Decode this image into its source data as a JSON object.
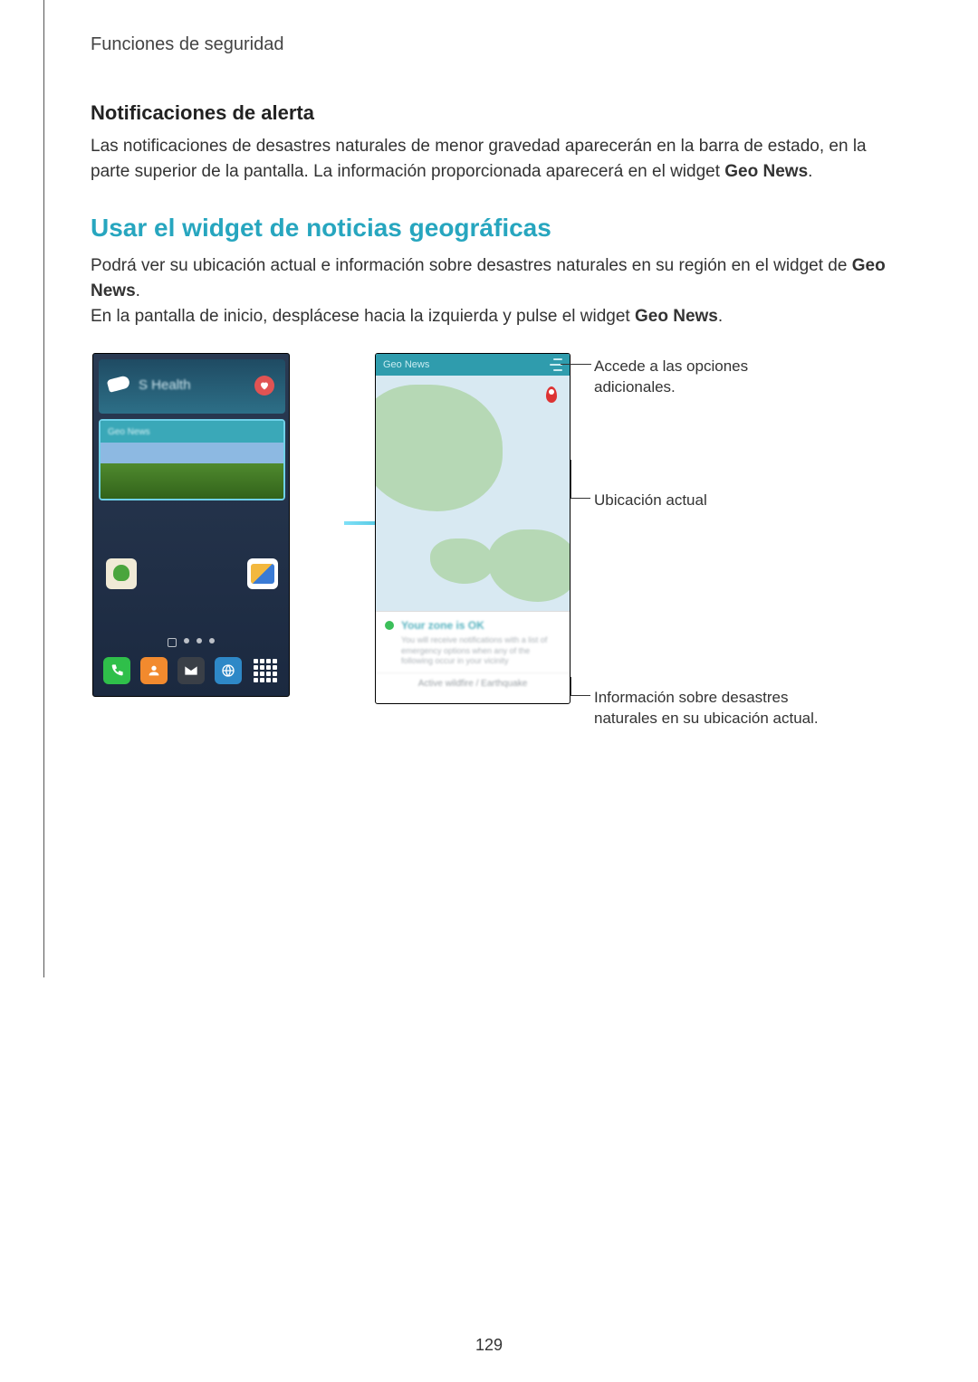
{
  "header": {
    "breadcrumb": "Funciones de seguridad"
  },
  "section1": {
    "heading": "Notificaciones de alerta",
    "para_pre": "Las notificaciones de desastres naturales de menor gravedad aparecerán en la barra de estado, en la parte superior de la pantalla. La información proporcionada aparecerá en el widget ",
    "para_bold": "Geo News",
    "para_post": "."
  },
  "section2": {
    "heading": "Usar el widget de noticias geográficas",
    "para_a_pre": "Podrá ver su ubicación actual e información sobre desastres naturales en su región en el widget de ",
    "para_a_bold": "Geo News",
    "para_a_post": ".",
    "para_b_pre": "En la pantalla de inicio, desplácese hacia la izquierda y pulse el widget ",
    "para_b_bold": "Geo News",
    "para_b_post": "."
  },
  "homescreen": {
    "shealth_label": "S Health",
    "geo_label": "Geo News"
  },
  "widget": {
    "header_label": "Geo News",
    "status_title": "Your zone is OK",
    "status_sub": "You will receive notifications with a list of emergency options when any of the following occur in your vicinity",
    "footer": "Active wildfire / Earthquake"
  },
  "callouts": {
    "options": "Accede a las opciones adicionales.",
    "location": "Ubicación actual",
    "info": "Información sobre desastres naturales en su ubicación actual."
  },
  "page_number": "129"
}
